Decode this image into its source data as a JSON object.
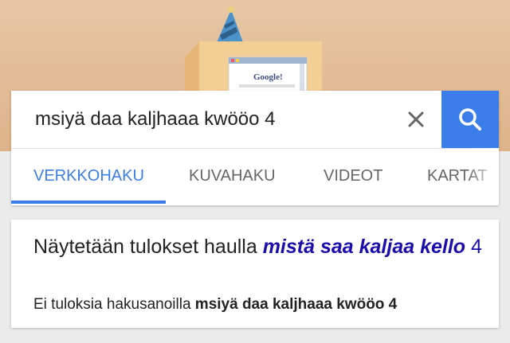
{
  "doodle": {
    "screen_logo_text": "Google!"
  },
  "search": {
    "value": "msiyä daa kaljhaaa kwööo 4",
    "clear_icon": "close-icon",
    "search_icon": "search-icon"
  },
  "tabs": [
    {
      "label": "VERKKOHAKU",
      "active": true
    },
    {
      "label": "KUVAHAKU",
      "active": false
    },
    {
      "label": "VIDEOT",
      "active": false
    },
    {
      "label": "KARTAT",
      "active": false
    }
  ],
  "result": {
    "showing_prefix": "Näytetään tulokset haulla",
    "corrected_bold_italic": "mistä saa kaljaa kello",
    "corrected_tail": "4",
    "no_results_prefix": "Ei tuloksia hakusanoilla",
    "original_query": "msiyä daa kaljhaaa kwööo 4"
  },
  "colors": {
    "accent": "#3b7de9",
    "link": "#1a0dab",
    "doodle_bg": "#e2bb94"
  }
}
